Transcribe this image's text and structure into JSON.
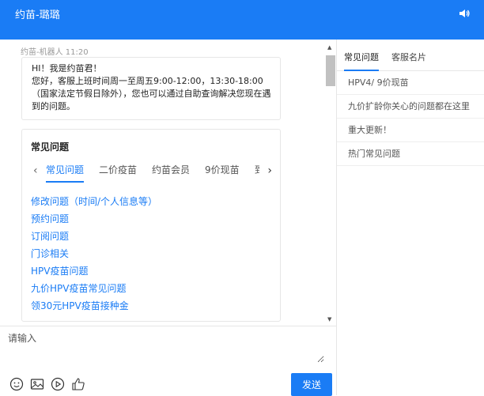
{
  "header": {
    "title": "约苗-璐璐",
    "sound_icon": "speaker-icon"
  },
  "chat": {
    "message": {
      "sender_time": "约苗-机器人 11:20",
      "text": "HI！我是约苗君！\n您好，客服上班时间周一至周五9:00-12:00，13:30-18:00（国家法定节假日除外），您也可以通过自助查询解决您现在遇到的问题。"
    },
    "faq_card": {
      "title": "常见问题",
      "tabs": [
        {
          "label": "常见问题",
          "active": true
        },
        {
          "label": "二价疫苗",
          "active": false
        },
        {
          "label": "约苗会员",
          "active": false
        },
        {
          "label": "9价现苗",
          "active": false
        },
        {
          "label": "到",
          "active": false
        }
      ],
      "links": [
        "修改问题（时间/个人信息等）",
        "预约问题",
        "订阅问题",
        "门诊相关",
        "HPV疫苗问题",
        "九价HPV疫苗常见问题",
        "领30元HPV疫苗接种金"
      ]
    }
  },
  "input": {
    "placeholder": "请输入",
    "send_label": "发送",
    "tools": [
      "emoji-icon",
      "image-icon",
      "play-icon",
      "thumbs-up-icon"
    ]
  },
  "side_panel": {
    "tabs": [
      "常见问题",
      "客服名片"
    ],
    "items": [
      "HPV4/ 9价现苗",
      "九价扩龄你关心的问题都在这里",
      "重大更新！",
      "热门常见问题"
    ]
  },
  "colors": {
    "accent": "#1a7cf5"
  }
}
